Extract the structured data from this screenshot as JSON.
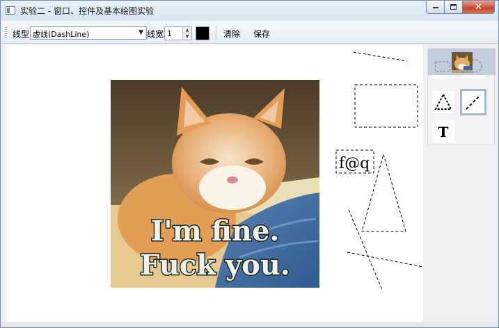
{
  "window": {
    "title": "实验二 - 窗口、控件及基本绘图实验",
    "minimize_glyph": "▭",
    "maximize_glyph": "▢",
    "close_glyph": "✕"
  },
  "toolbar": {
    "line_style_label": "线型",
    "line_style_value": "虚线(DashLine)",
    "dropdown_arrow": "▼",
    "line_width_label": "线宽",
    "line_width_value": "1",
    "spin_up": "▲",
    "spin_down": "▼",
    "color_value": "#000000",
    "clear_label": "清除",
    "save_label": "保存"
  },
  "canvas": {
    "meme_line1": "I'm fine.",
    "meme_line2": "Fuck you.",
    "text_item": "f@q"
  },
  "tools": {
    "text_tool_glyph": "T",
    "items": [
      "rect-tool",
      "ellipse-tool",
      "triangle-tool",
      "line-tool",
      "text-tool",
      "image-tool"
    ],
    "selected": "line-tool"
  },
  "colors": {
    "accent_selected": "#a8b8cb",
    "title_bar": "#dbe6f2",
    "close_button": "#c9472f"
  }
}
